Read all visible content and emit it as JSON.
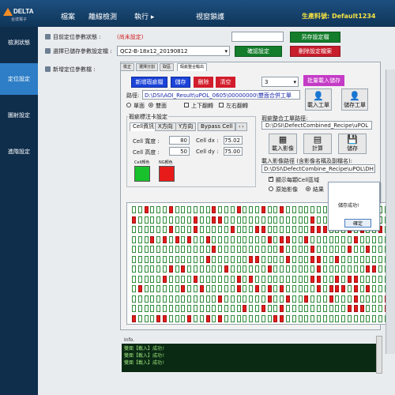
{
  "app": {
    "brand": "DELTA",
    "brand_sub": "台達電子",
    "product_label": "生產料號: Default1234"
  },
  "menu": [
    "檔案",
    "離線檢測",
    "執行 ▸",
    "",
    "視窗鎖護"
  ],
  "sidebar": [
    "檢測狀態",
    "定位設定",
    "圖射設定",
    "進階設定"
  ],
  "form": {
    "auto_label": "目前定位參數狀態 :",
    "auto_value": "(尚未設定)",
    "save_btn": "另存設定檔",
    "select_label": "選擇已儲存參數設定檔 :",
    "select_value": "QC2-B-18x12_20190812",
    "confirm_btn": "確認設定",
    "delete_btn": "刪除設定檔案",
    "new_label": "新增定位參數檔 :"
  },
  "tabs": [
    "檢正",
    "選擇分割",
    "取區",
    "瑕疵整合輸出"
  ],
  "tools": {
    "new_btn": "新增瑕疵檔",
    "save_btn": "儲存",
    "del_btn": "刪除",
    "clear_btn": "清空",
    "count": "3",
    "batch_btn": "批量載入儲存",
    "path_label": "路徑:",
    "path_value": "D:\\DSI\\AOI_Result\\uPOL_0605\\00000000\\雙面合併工單",
    "radio_single": "單面",
    "radio_double": "雙面",
    "chk_flip_v": "上下翻轉",
    "chk_flip_h": "左右翻轉",
    "load_work": "載入工單",
    "save_work": "儲存工單"
  },
  "mark": {
    "title": "瑕疵標注卡設定",
    "sub_tabs": [
      "Cell資訊",
      "X方向",
      "Y方向",
      "Bypass Cell"
    ],
    "w_label": "Cell 寬度 :",
    "w_value": "80",
    "h_label": "Cell 高度 :",
    "h_value": "50",
    "dx_label": "Cell dx :",
    "dx_value": "75.02",
    "dy_label": "Cell dy :",
    "dy_value": "75.00",
    "ok_label": "Cell顏色",
    "ng_label": "NG顏色",
    "ok_color": "#19c12c",
    "ng_color": "#e81b1b"
  },
  "merge": {
    "title": "瑕疵整合工單路徑:",
    "path": "D:\\DSI\\DefectCombined_Recipe\\uPOL",
    "load_img": "載入影像",
    "calc": "計算",
    "save": "儲存",
    "img_label": "載入影像路徑 (含影像名稱及副檔名):",
    "img_path": "D:\\DSI\\DefectCombine_Recipe\\uPOL\\DH1501-01",
    "chk_show": "顯示每顆Cell區域",
    "radio_orig": "原始影像",
    "radio_result": "結果"
  },
  "dialog": {
    "msg": "儲存成功!",
    "ok": "確定"
  },
  "info": {
    "label": "Info.",
    "log": [
      "雙面【載入】成功!",
      "雙面【載入】成功!",
      "雙面【載入】成功!"
    ]
  }
}
